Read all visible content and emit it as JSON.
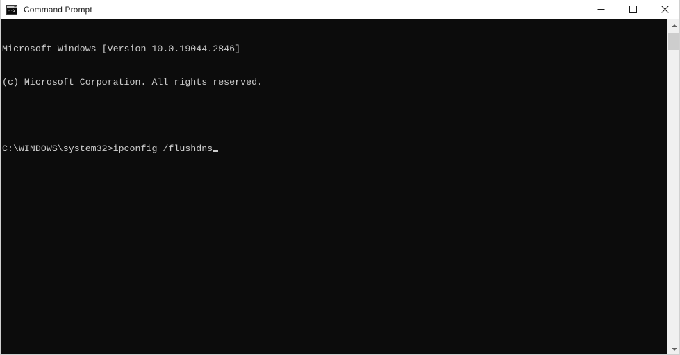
{
  "window": {
    "title": "Command Prompt",
    "icon": "command-prompt-icon",
    "icon_text": "c:\\",
    "background_color": "#0c0c0c",
    "titlebar_color": "#ffffff"
  },
  "controls": {
    "minimize_label": "Minimize",
    "maximize_label": "Maximize",
    "close_label": "Close"
  },
  "terminal": {
    "foreground_color": "#cccccc",
    "lines": [
      "Microsoft Windows [Version 10.0.19044.2846]",
      "(c) Microsoft Corporation. All rights reserved.",
      "",
      "C:\\WINDOWS\\system32>ipconfig /flushdns"
    ],
    "prompt": "C:\\WINDOWS\\system32>",
    "command": "ipconfig /flushdns",
    "cursor_visible": true
  },
  "scrollbar": {
    "up_arrow": "chevron-up-icon",
    "down_arrow": "chevron-down-icon",
    "thumb_position": "top"
  }
}
